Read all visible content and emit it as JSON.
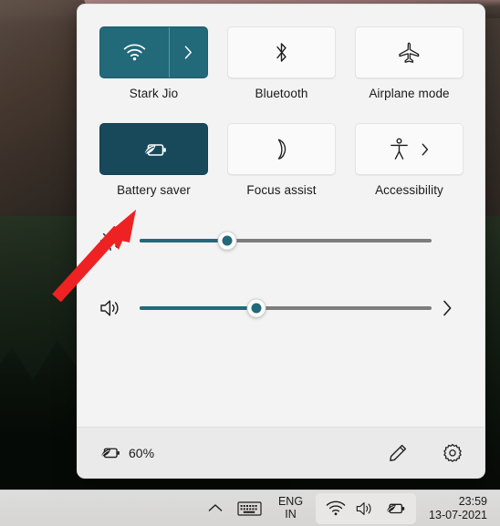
{
  "panel": {
    "tiles": [
      {
        "label": "Stark Jio",
        "icon": "wifi-icon",
        "state": "on",
        "split": true,
        "chevron": true
      },
      {
        "label": "Bluetooth",
        "icon": "bluetooth-icon",
        "state": "off",
        "split": false,
        "chevron": false
      },
      {
        "label": "Airplane mode",
        "icon": "airplane-icon",
        "state": "off",
        "split": false,
        "chevron": false
      },
      {
        "label": "Battery saver",
        "icon": "battery-saver-icon",
        "state": "on-dark",
        "split": false,
        "chevron": false
      },
      {
        "label": "Focus assist",
        "icon": "moon-icon",
        "state": "off",
        "split": false,
        "chevron": false
      },
      {
        "label": "Accessibility",
        "icon": "accessibility-icon",
        "state": "off",
        "split": false,
        "chevron": true
      }
    ],
    "sliders": [
      {
        "name": "brightness",
        "icon": "brightness-icon",
        "value": 30,
        "has_expand": false
      },
      {
        "name": "volume",
        "icon": "volume-icon",
        "value": 40,
        "has_expand": true
      }
    ],
    "footer": {
      "battery_icon": "battery-saver-icon",
      "battery_percent": "60%",
      "edit_label": "edit-quick-settings",
      "settings_label": "all-settings"
    }
  },
  "taskbar": {
    "show_hidden_icons": "chevron-up-icon",
    "keyboard": "touch-keyboard-icon",
    "language_line1": "ENG",
    "language_line2": "IN",
    "tray_icons": [
      "wifi-icon",
      "volume-icon",
      "battery-saver-icon"
    ],
    "time": "23:59",
    "date": "13-07-2021"
  },
  "annotation": {
    "arrow_color": "#ee2222",
    "points_to": "Battery saver"
  },
  "colors": {
    "accent_teal": "#22697a",
    "accent_teal_dark": "#17495b",
    "panel_bg": "#f3f3f3",
    "footer_bg": "#eaeaea",
    "taskbar_bg": "#d9d7d5"
  }
}
